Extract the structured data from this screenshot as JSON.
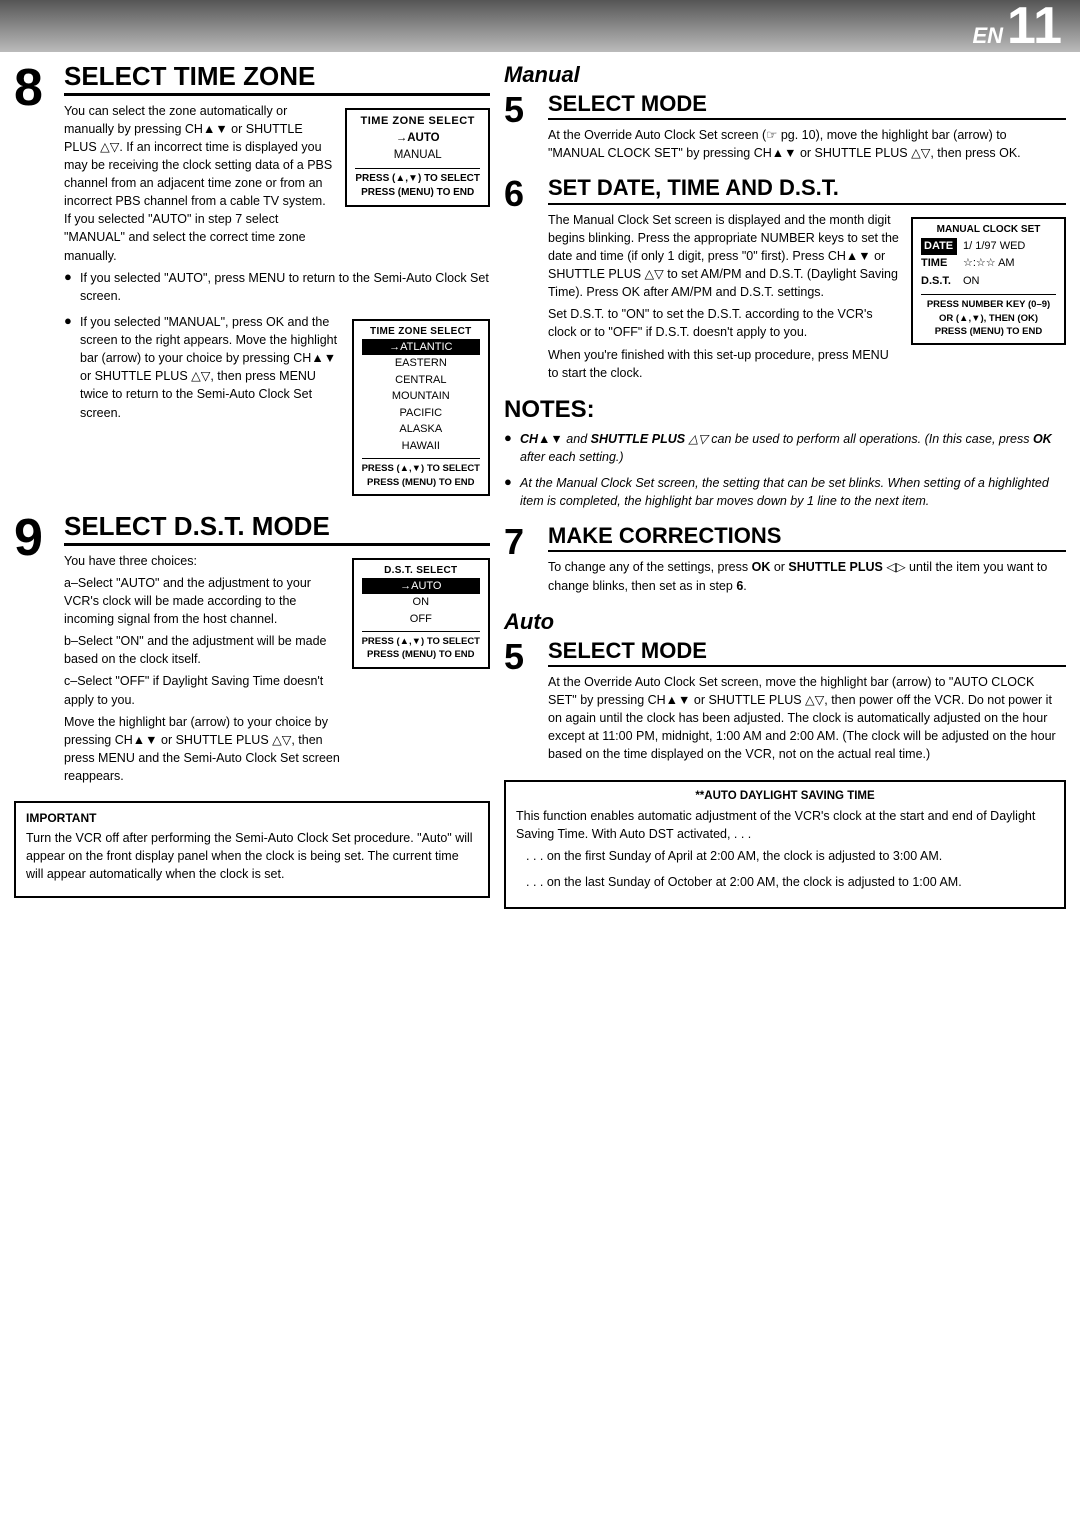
{
  "header": {
    "en_label": "EN",
    "page_number": "11"
  },
  "left_col": {
    "section8": {
      "title": "SELECT TIME ZONE",
      "step_number": "8",
      "para1": "You can select the zone automatically or manually by pressing CH▲▼ or SHUTTLE PLUS △▽. If an incorrect time is displayed you may be receiving the clock setting data of a PBS channel from an adjacent time zone or from an incorrect PBS channel from a cable TV system. If you selected \"AUTO\" in step 7 select \"MANUAL\" and select the correct time zone manually.",
      "bullet1": "If you selected \"AUTO\", press MENU to return to the Semi-Auto Clock Set screen.",
      "bullet2": "If you selected \"MANUAL\", press OK and the screen to the right appears. Move the highlight bar (arrow) to your choice by pressing CH▲▼ or SHUTTLE PLUS △▽, then press MENU twice to return to the Semi-Auto Clock Set screen.",
      "tz_select_box1": {
        "title": "TIME ZONE SELECT",
        "arrow": "→AUTO",
        "manual": "MANUAL",
        "footer_line1": "PRESS (▲,▼) TO SELECT",
        "footer_line2": "PRESS (MENU) TO END"
      },
      "tz_select_box2": {
        "title": "TIME ZONE SELECT",
        "arrow": "→ATLANTIC",
        "items": [
          "EASTERN",
          "CENTRAL",
          "MOUNTAIN",
          "PACIFIC",
          "ALASKA",
          "HAWAII"
        ],
        "footer_line1": "PRESS (▲,▼) TO SELECT",
        "footer_line2": "PRESS (MENU) TO END"
      }
    },
    "section9": {
      "title": "SELECT D.S.T. MODE",
      "step_number": "9",
      "para1": "You have three choices:",
      "choice_a": "a–Select \"AUTO\" and the adjustment to your VCR's clock will be made according to the incoming signal from the host channel.",
      "choice_b": "b–Select \"ON\" and the adjustment will be made based on the clock itself.",
      "choice_c": "c–Select \"OFF\" if Daylight Saving Time doesn't apply to you.",
      "para2": "Move the highlight bar (arrow) to your choice by pressing CH▲▼ or SHUTTLE PLUS △▽, then press MENU and the Semi-Auto Clock Set screen reappears.",
      "dst_box": {
        "title": "D.S.T. SELECT",
        "arrow": "→AUTO",
        "on": "ON",
        "off": "OFF",
        "footer_line1": "PRESS (▲,▼) TO SELECT",
        "footer_line2": "PRESS (MENU) TO END"
      }
    },
    "important_box": {
      "title": "IMPORTANT",
      "text": "Turn the VCR off after performing the Semi-Auto Clock Set procedure. \"Auto\" will appear on the front display panel when the clock is being set. The current time will appear automatically when the clock is set."
    }
  },
  "right_col": {
    "manual_label": "Manual",
    "section5_manual": {
      "title": "SELECT MODE",
      "step_number": "5",
      "text": "At the Override Auto Clock Set screen (☞ pg. 10), move the highlight bar (arrow) to \"MANUAL CLOCK SET\" by pressing CH▲▼ or SHUTTLE PLUS △▽, then press OK."
    },
    "section6": {
      "title": "SET DATE, TIME AND D.S.T.",
      "step_number": "6",
      "para1": "The Manual Clock Set screen is displayed and the month digit begins blinking. Press the appropriate NUMBER keys to set the date and time (if only 1 digit, press \"0\" first). Press CH▲▼ or SHUTTLE PLUS △▽ to set AM/PM and D.S.T. (Daylight Saving Time). Press OK after AM/PM and D.S.T. settings.",
      "para2": "Set D.S.T. to \"ON\" to set the D.S.T. according to the VCR's clock or to \"OFF\" if D.S.T. doesn't apply to you.",
      "para3": "When you're finished with this set-up procedure, press MENU to start the clock.",
      "mcs_box": {
        "title": "MANUAL CLOCK SET",
        "date_label": "DATE",
        "date_value": "1/ 1/97 WED",
        "time_label": "TIME",
        "time_value": "☆:☆☆ AM",
        "dst_label": "D.S.T.",
        "dst_value": "ON",
        "footer_line1": "PRESS NUMBER KEY (0–9)",
        "footer_line2": "OR (▲,▼), THEN (OK)",
        "footer_line3": "PRESS (MENU) TO END"
      }
    },
    "notes": {
      "title": "NOTES:",
      "bullet1": "CH▲▼ and SHUTTLE PLUS △▽ can be used to perform all operations. (In this case, press OK after each setting.)",
      "bullet2": "At the Manual Clock Set screen, the setting that can be set blinks. When setting of a highlighted item is completed, the highlight bar moves down by 1 line to the next item."
    },
    "corrections": {
      "title": "MAKE CORRECTIONS",
      "step_number": "7",
      "text": "To change any of the settings, press OK or SHUTTLE PLUS ◁▷ until the item you want to change blinks, then set as in step 6."
    },
    "auto_label": "Auto",
    "section5_auto": {
      "title": "SELECT MODE",
      "step_number": "5",
      "text": "At the Override Auto Clock Set screen, move the highlight bar (arrow) to \"AUTO CLOCK SET\" by pressing CH▲▼ or SHUTTLE PLUS △▽, then power off the VCR. Do not power it on again until the clock has been adjusted. The clock is automatically adjusted on the hour except at 11:00 PM, midnight, 1:00 AM and 2:00 AM. (The clock will be adjusted on the hour based on the time displayed on the VCR, not on the actual real time.)"
    },
    "auto_dst_box": {
      "title": "**AUTO DAYLIGHT SAVING TIME",
      "para1": "This function enables automatic adjustment of the VCR's clock at the start and end of Daylight Saving Time. With Auto DST activated, . . .",
      "bullet1": ". . . on the first Sunday of April at 2:00 AM, the clock is adjusted to 3:00 AM.",
      "bullet2": ". . . on the last Sunday of October at 2:00 AM, the clock is adjusted to 1:00 AM."
    }
  }
}
